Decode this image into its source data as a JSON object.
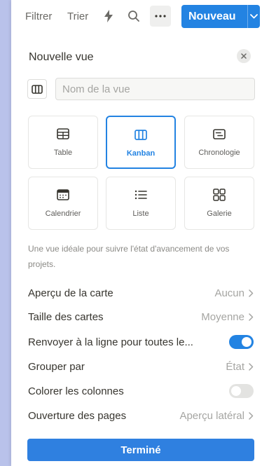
{
  "toolbar": {
    "filter_label": "Filtrer",
    "sort_label": "Trier",
    "automation_icon": "lightning-icon",
    "search_icon": "search-icon",
    "more_icon": "more-icon",
    "new_label": "Nouveau",
    "new_caret_icon": "chevron-down-icon",
    "accent_color": "#2383e2"
  },
  "panel": {
    "title": "Nouvelle vue",
    "close_icon": "close-icon",
    "name_placeholder": "Nom de la vue",
    "name_value": ""
  },
  "layouts": [
    {
      "label": "Table",
      "icon": "table-icon",
      "selected": false
    },
    {
      "label": "Kanban",
      "icon": "board-icon",
      "selected": true
    },
    {
      "label": "Chronologie",
      "icon": "timeline-icon",
      "selected": false
    },
    {
      "label": "Calendrier",
      "icon": "calendar-icon",
      "selected": false
    },
    {
      "label": "Liste",
      "icon": "list-icon",
      "selected": false
    },
    {
      "label": "Galerie",
      "icon": "gallery-icon",
      "selected": false
    }
  ],
  "description": "Une vue idéale pour suivre l'état d'avancement de vos projets.",
  "settings": [
    {
      "label": "Aperçu de la carte",
      "value": "Aucun"
    },
    {
      "label": "Taille des cartes",
      "value": "Moyenne"
    },
    {
      "label": "Renvoyer à la ligne pour toutes le...",
      "toggle": true
    },
    {
      "label": "Grouper par",
      "value": "État"
    },
    {
      "label": "Colorer les colonnes",
      "toggle": false
    },
    {
      "label": "Ouverture des pages",
      "value": "Aperçu latéral"
    }
  ],
  "done_label": "Terminé"
}
